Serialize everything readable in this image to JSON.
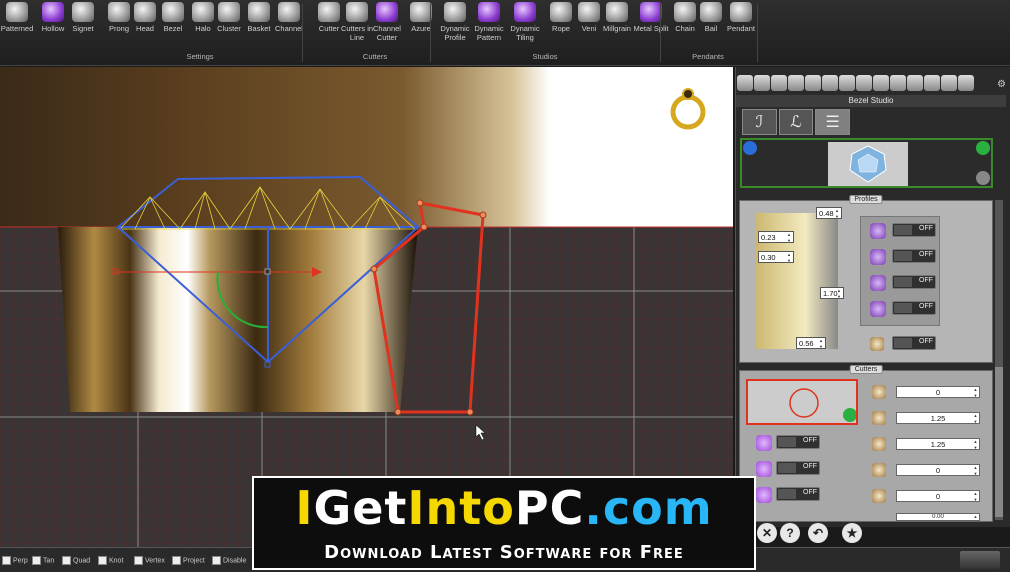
{
  "ribbon": {
    "buttons": [
      {
        "label": "Patterned",
        "icon": "patterned-icon"
      },
      {
        "label": "Hollow",
        "icon": "hollow-icon"
      },
      {
        "label": "Signet",
        "icon": "signet-icon"
      },
      {
        "label": "Prong",
        "icon": "prong-icon"
      },
      {
        "label": "Head",
        "icon": "head-icon"
      },
      {
        "label": "Bezel",
        "icon": "bezel-icon"
      },
      {
        "label": "Halo",
        "icon": "halo-icon"
      },
      {
        "label": "Cluster",
        "icon": "cluster-icon"
      },
      {
        "label": "Basket",
        "icon": "basket-icon"
      },
      {
        "label": "Channel",
        "icon": "channel-icon"
      },
      {
        "label": "Cutter",
        "icon": "cutter-icon"
      },
      {
        "label": "Cutters in Line",
        "icon": "cutters-in-line-icon"
      },
      {
        "label": "Channel Cutter",
        "icon": "channel-cutter-icon"
      },
      {
        "label": "Azure",
        "icon": "azure-icon"
      },
      {
        "label": "Dynamic Profile",
        "icon": "dynamic-profile-icon"
      },
      {
        "label": "Dynamic Pattern",
        "icon": "dynamic-pattern-icon"
      },
      {
        "label": "Dynamic Tiling",
        "icon": "dynamic-tiling-icon"
      },
      {
        "label": "Rope",
        "icon": "rope-icon"
      },
      {
        "label": "Veni",
        "icon": "veni-icon"
      },
      {
        "label": "Millgrain",
        "icon": "millgrain-icon"
      },
      {
        "label": "Metal Split",
        "icon": "metal-split-icon"
      },
      {
        "label": "Chain",
        "icon": "chain-icon"
      },
      {
        "label": "Bail",
        "icon": "bail-icon"
      },
      {
        "label": "Pendant",
        "icon": "pendant-icon"
      }
    ],
    "groups": {
      "settings": "Settings",
      "cutters": "Cutters",
      "studios": "Studios",
      "pendants": "Pendants"
    }
  },
  "panel": {
    "title": "Bezel Studio",
    "profiles_label": "Profiles",
    "cutters_label": "Cutters",
    "profile_values": {
      "top_width": "0.48",
      "left_a": "0.23",
      "left_b": "0.30",
      "height": "1.70",
      "bottom_width": "0.56"
    },
    "profile_toggles": [
      "OFF",
      "OFF",
      "OFF",
      "OFF",
      "OFF"
    ],
    "cutter_toggles": [
      "OFF",
      "OFF",
      "OFF"
    ],
    "cutter_values": [
      "0",
      "1.25",
      "1.25",
      "0",
      "0",
      "0.00"
    ]
  },
  "snap_bar": {
    "items": [
      "Perp",
      "Tan",
      "Quad",
      "Knot",
      "Vertex",
      "Project",
      "Disable"
    ]
  },
  "watermark": {
    "line1_parts": [
      "I",
      "Get",
      "Into",
      "PC",
      ".com"
    ],
    "line2": "Download Latest Software for Free"
  },
  "colors": {
    "accent_green": "#3a8a2a",
    "wire_blue": "#3a5fd6",
    "wire_red": "#e0321e",
    "wire_yellow": "#e8d23a",
    "watermark_blue": "#29b6f6",
    "watermark_yellow": "#f5d800"
  }
}
